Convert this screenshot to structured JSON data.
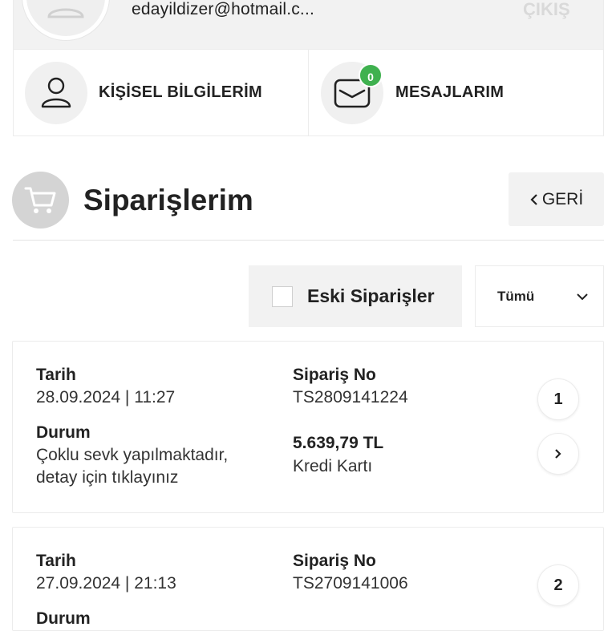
{
  "profile": {
    "email": "edayildizer@hotmail.c...",
    "logout_label": "ÇIKIŞ"
  },
  "quick_links": {
    "personal_label": "KİŞİSEL BİLGİLERİM",
    "messages_label": "MESAJLARIM",
    "messages_count": "0",
    "badge_color": "#3fb14f"
  },
  "header": {
    "title": "Siparişlerim",
    "back_label": "GERİ"
  },
  "filters": {
    "old_orders_label": "Eski Siparişler",
    "status_selected": "Tümü"
  },
  "orders": [
    {
      "date_label": "Tarih",
      "date": "28.09.2024 | 11:27",
      "status_label": "Durum",
      "status_line1": "Çoklu sevk yapılmaktadır,",
      "status_line2": "detay için tıklayınız",
      "order_no_label": "Sipariş No",
      "order_no": "TS2809141224",
      "amount": "5.639,79 TL",
      "payment": "Kredi Kartı",
      "index": "1"
    },
    {
      "date_label": "Tarih",
      "date": "27.09.2024 | 21:13",
      "status_label": "Durum",
      "order_no_label": "Sipariş No",
      "order_no": "TS2709141006",
      "index": "2"
    }
  ]
}
